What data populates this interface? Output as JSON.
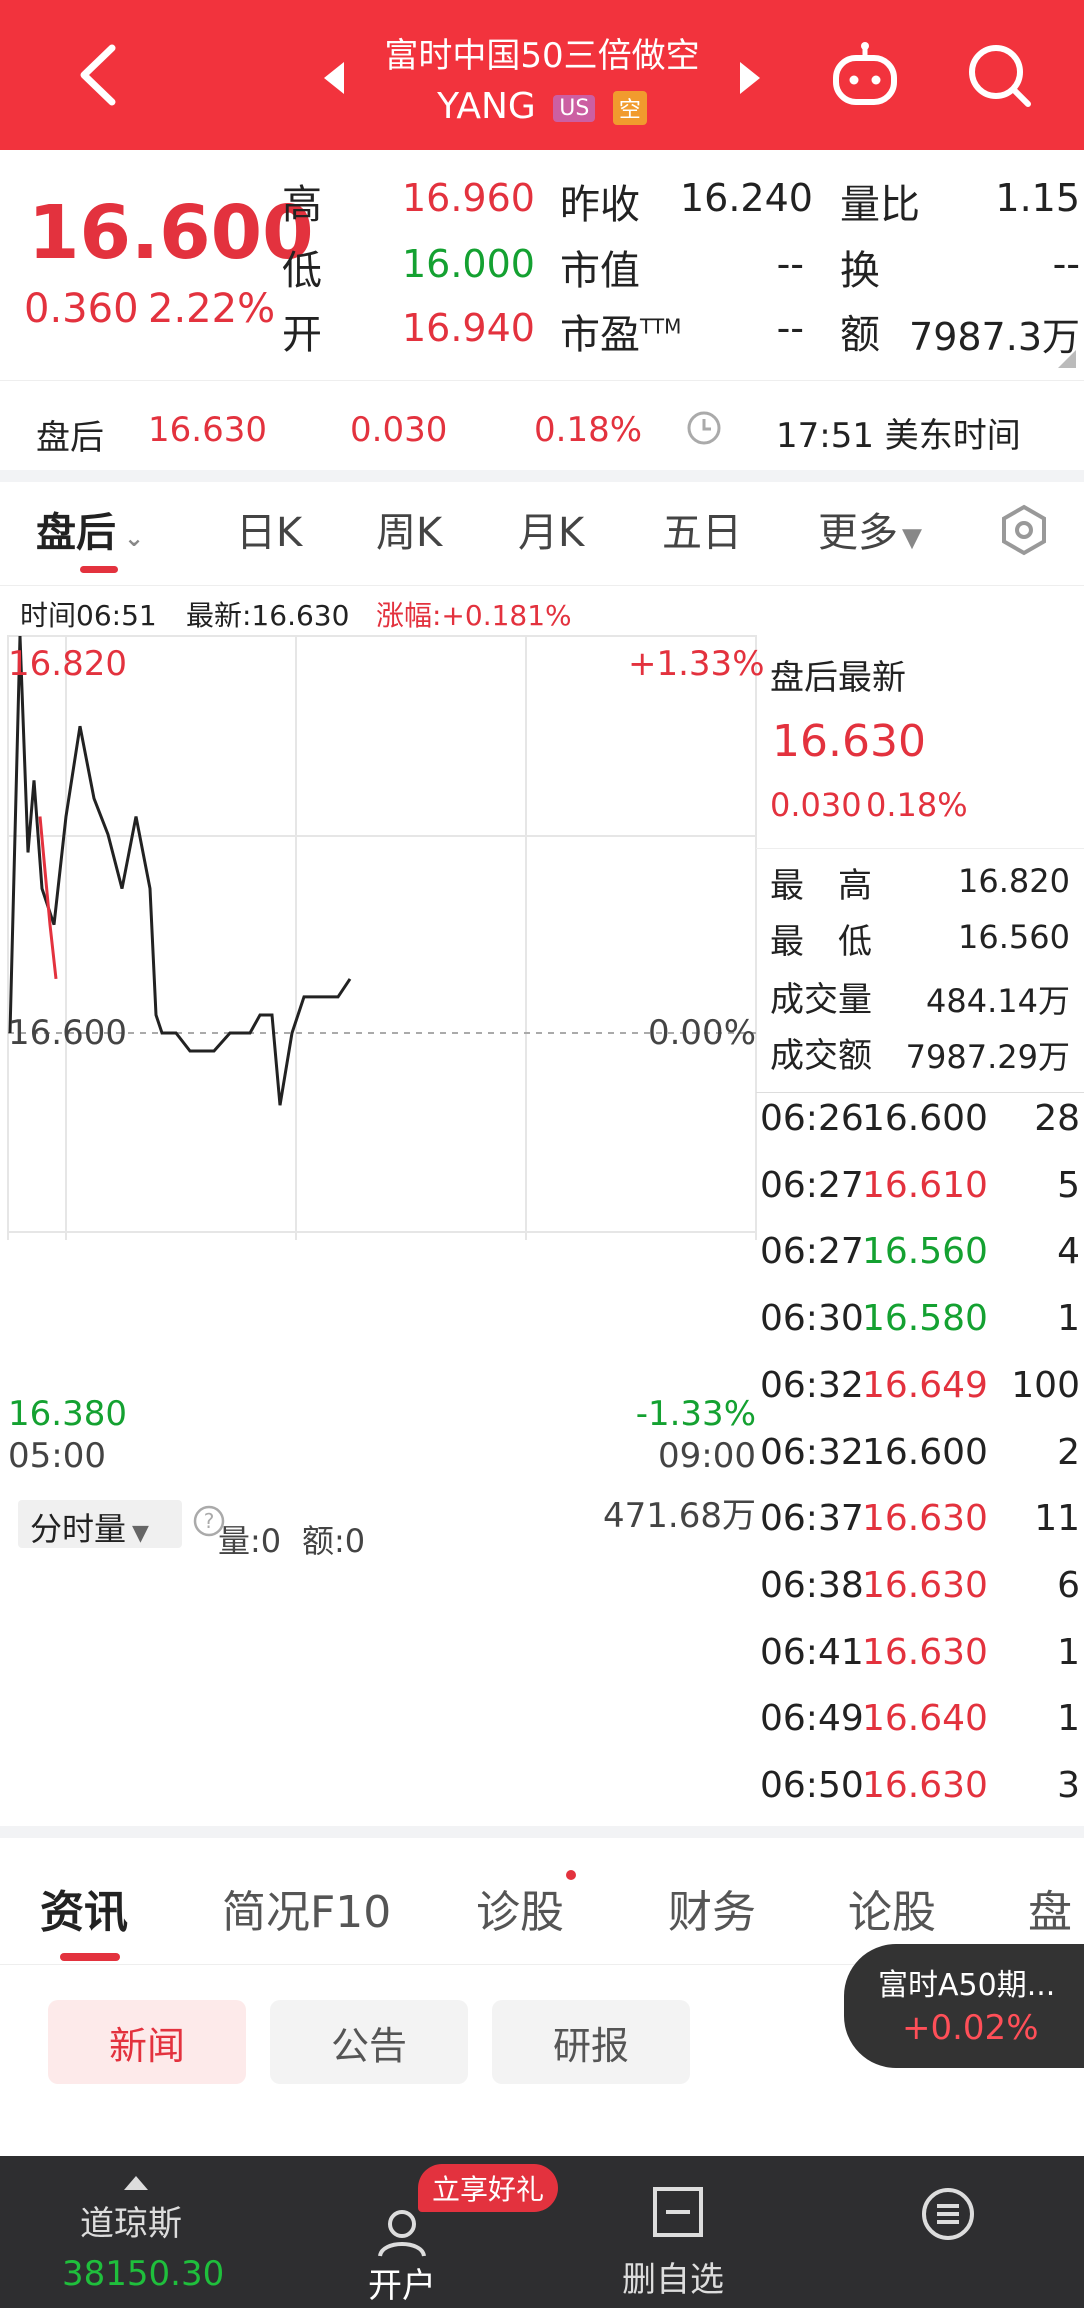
{
  "header": {
    "title": "富时中国50三倍做空",
    "ticker": "YANG",
    "tag_market": "US",
    "tag_short": "空"
  },
  "quote": {
    "price": "16.600",
    "change": "0.360",
    "change_pct": "2.22%",
    "stats": [
      {
        "label": "高",
        "value": "16.960",
        "color": "red"
      },
      {
        "label": "低",
        "value": "16.000",
        "color": "green"
      },
      {
        "label": "开",
        "value": "16.940",
        "color": "red"
      }
    ],
    "stats2": [
      {
        "label": "昨收",
        "value": "16.240"
      },
      {
        "label": "市值",
        "value": "--"
      },
      {
        "label": "市盈TTM",
        "value": "--"
      }
    ],
    "stats3": [
      {
        "label": "量比",
        "value": "1.15"
      },
      {
        "label": "换",
        "value": "--"
      },
      {
        "label": "额",
        "value": "7987.3万"
      }
    ]
  },
  "after_hours": {
    "label": "盘后",
    "price": "16.630",
    "change": "0.030",
    "change_pct": "0.18%",
    "time": "17:51 美东时间"
  },
  "tabs": [
    "盘后",
    "日K",
    "周K",
    "月K",
    "五日",
    "更多"
  ],
  "chart_info": {
    "time": "时间06:51",
    "latest": "最新:16.630",
    "change": "涨幅:+0.181%"
  },
  "chart_data": {
    "type": "line",
    "x_range": [
      "05:00",
      "09:00"
    ],
    "ylim": [
      16.38,
      16.82
    ],
    "y_labels": {
      "top": "16.820",
      "mid": "16.600",
      "bottom": "16.380"
    },
    "pct_labels": {
      "top": "+1.33%",
      "mid": "0.00%",
      "bottom": "-1.33%"
    },
    "x_labels": [
      "05:00",
      "09:00"
    ],
    "series": [
      {
        "values": [
          16.6,
          16.82,
          16.7,
          16.74,
          16.68,
          16.66,
          16.72,
          16.77,
          16.73,
          16.71,
          16.68,
          16.72,
          16.68,
          16.61,
          16.6,
          16.6,
          16.59,
          16.59,
          16.6,
          16.6,
          16.61,
          16.61,
          16.56,
          16.6,
          16.62,
          16.62,
          16.62,
          16.63
        ]
      }
    ],
    "volume_max_label": "471.68万",
    "volume_title": "分时量",
    "volume_value": "量:0",
    "amount_value": "额:0"
  },
  "side_panel": {
    "title": "盘后最新",
    "price": "16.630",
    "change": "0.030",
    "change_pct": "0.18%",
    "rows": [
      {
        "label": "最　高",
        "value": "16.820"
      },
      {
        "label": "最　低",
        "value": "16.560"
      },
      {
        "label": "成交量",
        "value": "484.14万"
      },
      {
        "label": "成交额",
        "value": "7987.29万"
      }
    ],
    "ticks": [
      {
        "time": "06:26",
        "price": "16.600",
        "vol": "28",
        "color": "black"
      },
      {
        "time": "06:27",
        "price": "16.610",
        "vol": "5",
        "color": "red"
      },
      {
        "time": "06:27",
        "price": "16.560",
        "vol": "4",
        "color": "green"
      },
      {
        "time": "06:30",
        "price": "16.580",
        "vol": "1",
        "color": "green"
      },
      {
        "time": "06:32",
        "price": "16.649",
        "vol": "100",
        "color": "red"
      },
      {
        "time": "06:32",
        "price": "16.600",
        "vol": "2",
        "color": "black"
      },
      {
        "time": "06:37",
        "price": "16.630",
        "vol": "11",
        "color": "red"
      },
      {
        "time": "06:38",
        "price": "16.630",
        "vol": "6",
        "color": "red"
      },
      {
        "time": "06:41",
        "price": "16.630",
        "vol": "1",
        "color": "red"
      },
      {
        "time": "06:49",
        "price": "16.640",
        "vol": "1",
        "color": "red"
      },
      {
        "time": "06:50",
        "price": "16.630",
        "vol": "3",
        "color": "red"
      }
    ]
  },
  "info_tabs": [
    "资讯",
    "简况F10",
    "诊股",
    "财务",
    "论股",
    "盘"
  ],
  "sub_tabs": [
    "新闻",
    "公告",
    "研报"
  ],
  "float_widget": {
    "name": "富时A50期...",
    "change": "+0.02%"
  },
  "bottom_nav": {
    "index_name": "道琼斯",
    "index_value": "38150.30",
    "open_label": "开户",
    "open_badge": "立享好礼",
    "watch_label": "删自选"
  },
  "colors": {
    "red": "#e3323e",
    "green": "#14a131",
    "header": "#f2333d"
  }
}
